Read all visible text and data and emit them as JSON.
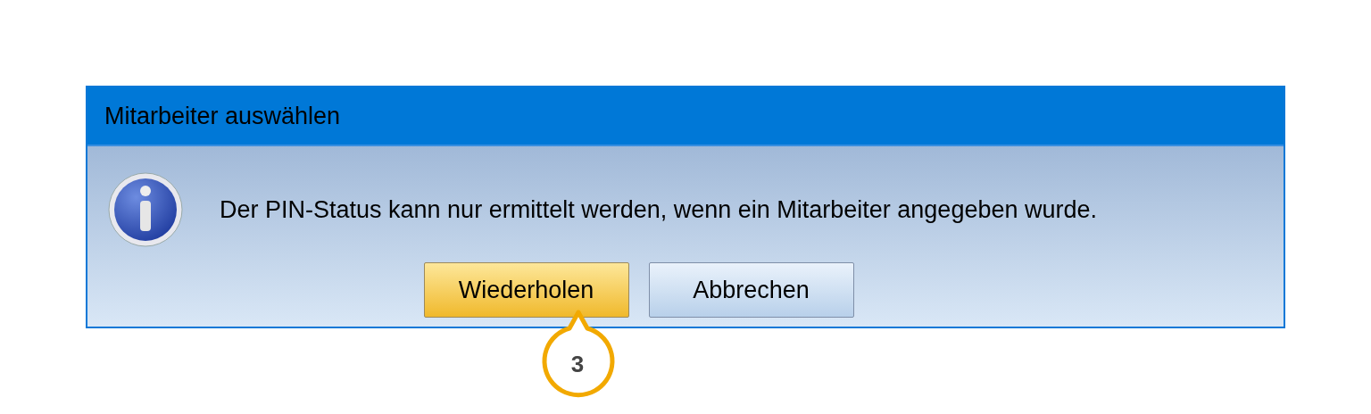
{
  "dialog": {
    "title": "Mitarbeiter auswählen",
    "message": "Der PIN-Status kann nur ermittelt werden, wenn ein Mitarbeiter angegeben wurde.",
    "buttons": [
      {
        "label": "Wiederholen",
        "kind": "highlighted"
      },
      {
        "label": "Abbrechen",
        "kind": "normal"
      }
    ]
  },
  "callout": {
    "label": "3"
  }
}
